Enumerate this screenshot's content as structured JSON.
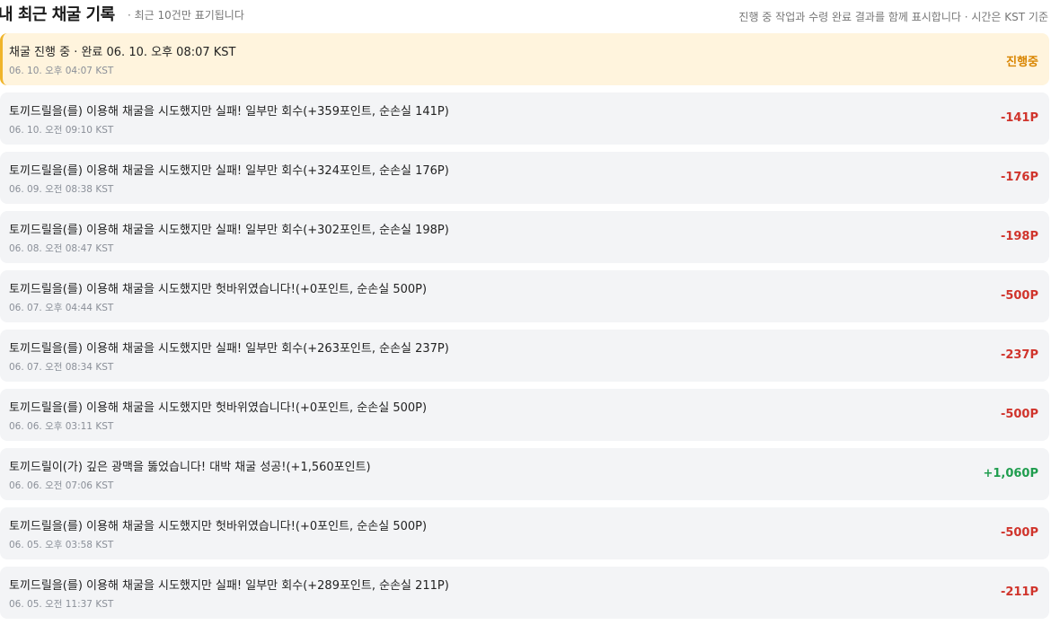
{
  "header": {
    "title": "내 최근 채굴 기록",
    "subtitle": "· 최근 10건만 표기됩니다",
    "note": "진행 중 작업과 수령 완료 결과를 함께 표시합니다 · 시간은 KST 기준"
  },
  "records": [
    {
      "message": "채굴 진행 중 · 완료 06. 10. 오후 08:07 KST",
      "time": "06. 10. 오후 04:07 KST",
      "amount": "진행중",
      "status": "in-progress"
    },
    {
      "message": "토끼드릴을(를) 이용해 채굴을 시도했지만 실패! 일부만 회수(+359포인트, 순손실 141P)",
      "time": "06. 10. 오전 09:10 KST",
      "amount": "-141P",
      "status": "loss"
    },
    {
      "message": "토끼드릴을(를) 이용해 채굴을 시도했지만 실패! 일부만 회수(+324포인트, 순손실 176P)",
      "time": "06. 09. 오전 08:38 KST",
      "amount": "-176P",
      "status": "loss"
    },
    {
      "message": "토끼드릴을(를) 이용해 채굴을 시도했지만 실패! 일부만 회수(+302포인트, 순손실 198P)",
      "time": "06. 08. 오전 08:47 KST",
      "amount": "-198P",
      "status": "loss"
    },
    {
      "message": "토끼드릴을(를) 이용해 채굴을 시도했지만 헛바위였습니다!(+0포인트, 순손실 500P)",
      "time": "06. 07. 오후 04:44 KST",
      "amount": "-500P",
      "status": "loss"
    },
    {
      "message": "토끼드릴을(를) 이용해 채굴을 시도했지만 실패! 일부만 회수(+263포인트, 순손실 237P)",
      "time": "06. 07. 오전 08:34 KST",
      "amount": "-237P",
      "status": "loss"
    },
    {
      "message": "토끼드릴을(를) 이용해 채굴을 시도했지만 헛바위였습니다!(+0포인트, 순손실 500P)",
      "time": "06. 06. 오후 03:11 KST",
      "amount": "-500P",
      "status": "loss"
    },
    {
      "message": "토끼드릴이(가) 깊은 광맥을 뚫었습니다! 대박 채굴 성공!(+1,560포인트)",
      "time": "06. 06. 오전 07:06 KST",
      "amount": "+1,060P",
      "status": "gain"
    },
    {
      "message": "토끼드릴을(를) 이용해 채굴을 시도했지만 헛바위였습니다!(+0포인트, 순손실 500P)",
      "time": "06. 05. 오후 03:58 KST",
      "amount": "-500P",
      "status": "loss"
    },
    {
      "message": "토끼드릴을(를) 이용해 채굴을 시도했지만 실패! 일부만 회수(+289포인트, 순손실 211P)",
      "time": "06. 05. 오전 11:37 KST",
      "amount": "-211P",
      "status": "loss"
    }
  ],
  "colors": {
    "loss": "#d0342c",
    "gain": "#1f9d4e",
    "in_progress": "#d98500",
    "active_background": "#fff4dd",
    "active_border": "#f0b429",
    "row_background": "#f3f4f6"
  }
}
